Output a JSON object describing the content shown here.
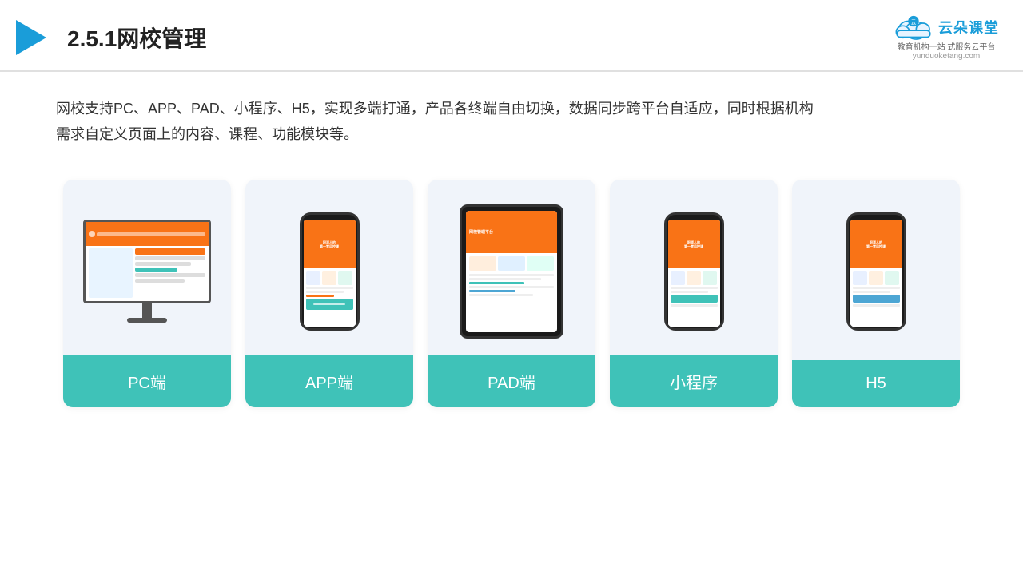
{
  "header": {
    "title": "2.5.1网校管理",
    "logo_main": "云朵课堂",
    "logo_url": "yunduoketang.com",
    "logo_subtitle_line1": "教育机构一站",
    "logo_subtitle_line2": "式服务云平台"
  },
  "description": {
    "text": "网校支持PC、APP、PAD、小程序、H5，实现多端打通，产品各终端自由切换，数据同步跨平台自适应，同时根据机构",
    "text2": "需求自定义页面上的内容、课程、功能模块等。"
  },
  "cards": [
    {
      "id": "pc",
      "label": "PC端"
    },
    {
      "id": "app",
      "label": "APP端"
    },
    {
      "id": "pad",
      "label": "PAD端"
    },
    {
      "id": "miniprogram",
      "label": "小程序"
    },
    {
      "id": "h5",
      "label": "H5"
    }
  ],
  "colors": {
    "accent": "#3fc2b8",
    "header_blue": "#1a9dd9",
    "dark": "#333"
  }
}
